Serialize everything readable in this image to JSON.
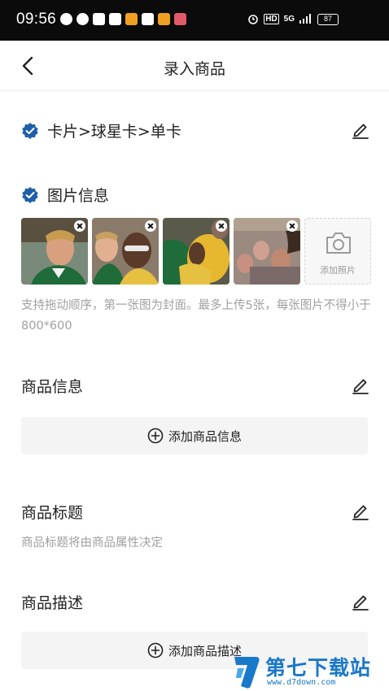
{
  "status_bar": {
    "time": "09:56",
    "network": "HD",
    "signal": "5G",
    "battery": "87"
  },
  "nav": {
    "title": "录入商品"
  },
  "category": {
    "path": "卡片>球星卡>单卡"
  },
  "image_section": {
    "title": "图片信息",
    "add_photo_label": "添加照片",
    "hint": "支持拖动顺序，第一张图为封面。最多上传5张，每张图片不得小于800*600"
  },
  "product_info": {
    "title": "商品信息",
    "add_label": "添加商品信息"
  },
  "product_title": {
    "title": "商品标题",
    "hint": "商品标题将由商品属性决定"
  },
  "product_desc": {
    "title": "商品描述",
    "add_label": "添加商品描述"
  },
  "watermark": {
    "brand": "第七下载站",
    "url": "www.d7down.com"
  },
  "colors": {
    "check_blue": "#1f5fa8",
    "text": "#222222",
    "hint": "#a0a0a0",
    "bar_bg": "#f4f4f4"
  }
}
